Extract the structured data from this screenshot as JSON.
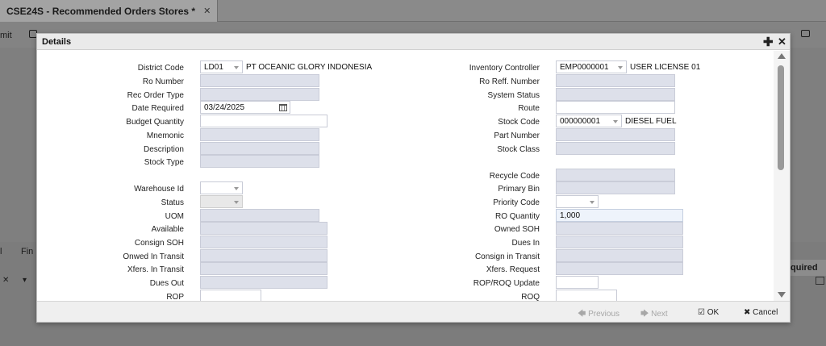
{
  "app": {
    "tab_title": "CSE24S - Recommended Orders Stores *",
    "tab_close": "✕",
    "toolbar_submit": "mit",
    "bottom_tabs": [
      "l",
      "Fin"
    ],
    "grid_header": "quired",
    "filter_x": "✕",
    "filter_caret": "▾"
  },
  "modal": {
    "title": "Details",
    "add_glyph": "✚",
    "close_glyph": "✕"
  },
  "left": {
    "district_code": {
      "label": "District Code",
      "value": "LD01",
      "description": "PT OCEANIC GLORY INDONESIA"
    },
    "ro_number": {
      "label": "Ro Number",
      "value": ""
    },
    "rec_order_type": {
      "label": "Rec Order Type",
      "value": ""
    },
    "date_required": {
      "label": "Date Required",
      "value": "03/24/2025"
    },
    "budget_quantity": {
      "label": "Budget Quantity",
      "value": ""
    },
    "mnemonic": {
      "label": "Mnemonic",
      "value": ""
    },
    "description": {
      "label": "Description",
      "value": ""
    },
    "stock_type": {
      "label": "Stock Type",
      "value": ""
    },
    "warehouse_id": {
      "label": "Warehouse Id",
      "value": ""
    },
    "status": {
      "label": "Status",
      "value": ""
    },
    "uom": {
      "label": "UOM",
      "value": ""
    },
    "available": {
      "label": "Available",
      "value": ""
    },
    "consign_soh": {
      "label": "Consign SOH",
      "value": ""
    },
    "onwed_in_transit": {
      "label": "Onwed In Transit",
      "value": ""
    },
    "xfers_in_transit": {
      "label": "Xfers. In Transit",
      "value": ""
    },
    "dues_out": {
      "label": "Dues Out",
      "value": ""
    },
    "rop": {
      "label": "ROP",
      "value": ""
    }
  },
  "right": {
    "inventory_controller": {
      "label": "Inventory Controller",
      "value": "EMP0000001",
      "description": "USER LICENSE 01"
    },
    "ro_reff_number": {
      "label": "Ro Reff. Number",
      "value": ""
    },
    "system_status": {
      "label": "System Status",
      "value": ""
    },
    "route": {
      "label": "Route",
      "value": ""
    },
    "stock_code": {
      "label": "Stock Code",
      "value": "000000001",
      "description": "DIESEL FUEL"
    },
    "part_number": {
      "label": "Part Number",
      "value": ""
    },
    "stock_class": {
      "label": "Stock Class",
      "value": ""
    },
    "recycle_code": {
      "label": "Recycle Code",
      "value": ""
    },
    "primary_bin": {
      "label": "Primary Bin",
      "value": ""
    },
    "priority_code": {
      "label": "Priority Code",
      "value": ""
    },
    "ro_quantity": {
      "label": "RO Quantity",
      "value": "1,000"
    },
    "owned_soh": {
      "label": "Owned SOH",
      "value": ""
    },
    "dues_in": {
      "label": "Dues In",
      "value": ""
    },
    "consign_in_transit": {
      "label": "Consign in Transit",
      "value": ""
    },
    "xfers_request": {
      "label": "Xfers. Request",
      "value": ""
    },
    "rop_roq_update": {
      "label": "ROP/ROQ Update",
      "value": ""
    },
    "roq": {
      "label": "ROQ",
      "value": ""
    }
  },
  "footer": {
    "previous": "🡄 Previous",
    "next": "🡆 Next",
    "ok": "☑ OK",
    "cancel": "✖ Cancel"
  }
}
